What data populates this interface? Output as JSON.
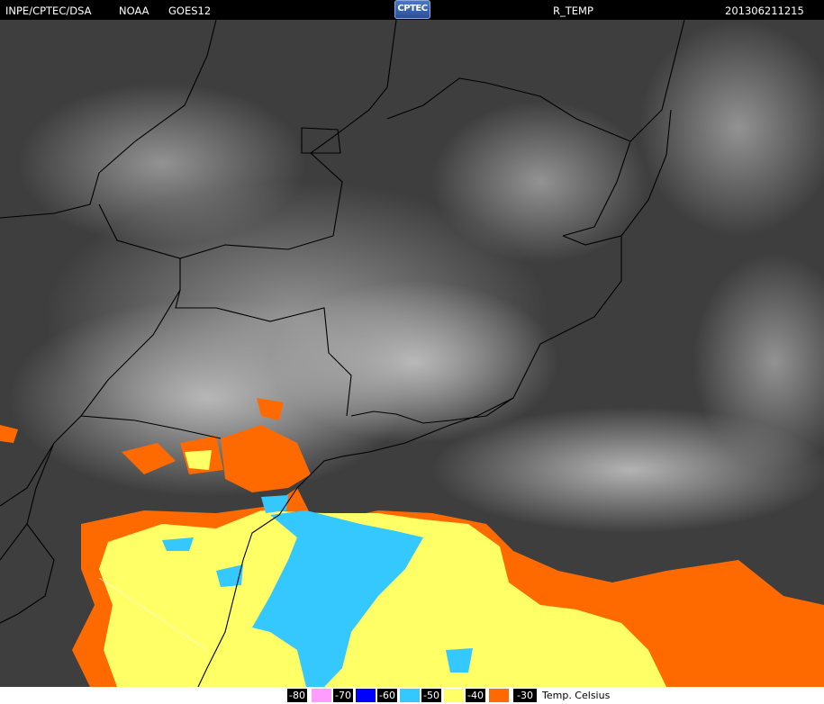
{
  "header": {
    "source": "INPE/CPTEC/DSA",
    "agency": "NOAA",
    "satellite": "GOES12",
    "logo_text": "CPTEC",
    "product": "R_TEMP",
    "timestamp": "201306211215"
  },
  "legend": {
    "items": [
      {
        "label": "-80",
        "color": "#ff9cff"
      },
      {
        "label": "-70",
        "color": "#000000"
      },
      {
        "label": "-60",
        "color": "#0000ff"
      },
      {
        "label": "-50",
        "color": "#35c8ff"
      },
      {
        "label": "-40",
        "color": "#ffff66"
      },
      {
        "label": "-30",
        "color": "#ff6a00"
      }
    ],
    "unit": "Temp. Celsius"
  },
  "colors": {
    "background": "#000000",
    "cloud_cold": "#35c8ff",
    "cloud_mid": "#ffff66",
    "cloud_warm": "#ff6a00",
    "ground": "#4a4a4a",
    "border_lines": "#000000"
  }
}
